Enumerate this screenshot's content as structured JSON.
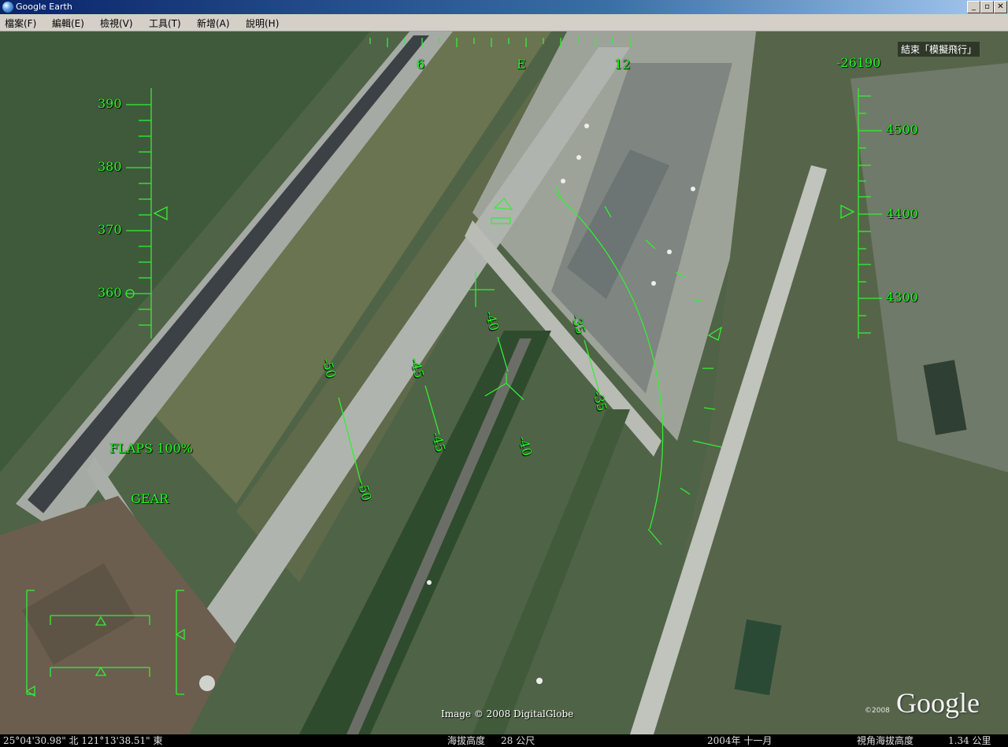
{
  "window": {
    "title": "Google Earth",
    "controls": {
      "minimize": "_",
      "restore": "▫",
      "close": "✕"
    }
  },
  "menu": [
    {
      "label": "檔案(F)"
    },
    {
      "label": "編輯(E)"
    },
    {
      "label": "檢視(V)"
    },
    {
      "label": "工具(T)"
    },
    {
      "label": "新增(A)"
    },
    {
      "label": "說明(H)"
    }
  ],
  "flight_sim": {
    "exit_button": "結束「模擬飛行」",
    "heading_labels": [
      "6",
      "E",
      "12"
    ],
    "vertical_speed": "-26190",
    "speed_labels": [
      "390",
      "380",
      "370",
      "360"
    ],
    "altitude_labels": [
      "4500",
      "4400",
      "4300"
    ],
    "pitch_labels": [
      "-50",
      "-45",
      "-40",
      "-35",
      "-35",
      "-40",
      "-45",
      "-50"
    ],
    "flaps": "FLAPS 100%",
    "gear": "GEAR"
  },
  "imagery": {
    "credit": "Image © 2008 DigitalGlobe",
    "logo": "Google",
    "logo_copyright": "©2008"
  },
  "status": {
    "coords": "25°04'30.98\" 北  121°13'38.51\" 東",
    "elevation_label": "海拔高度",
    "elevation_value": "28 公尺",
    "date": "2004年 十一月",
    "eye_alt_label": "視角海拔高度",
    "eye_alt_value": "1.34 公里"
  },
  "colors": {
    "hud": "#22ff22",
    "title_bar": "#0a246a",
    "menu_bg": "#d4d0c8"
  }
}
